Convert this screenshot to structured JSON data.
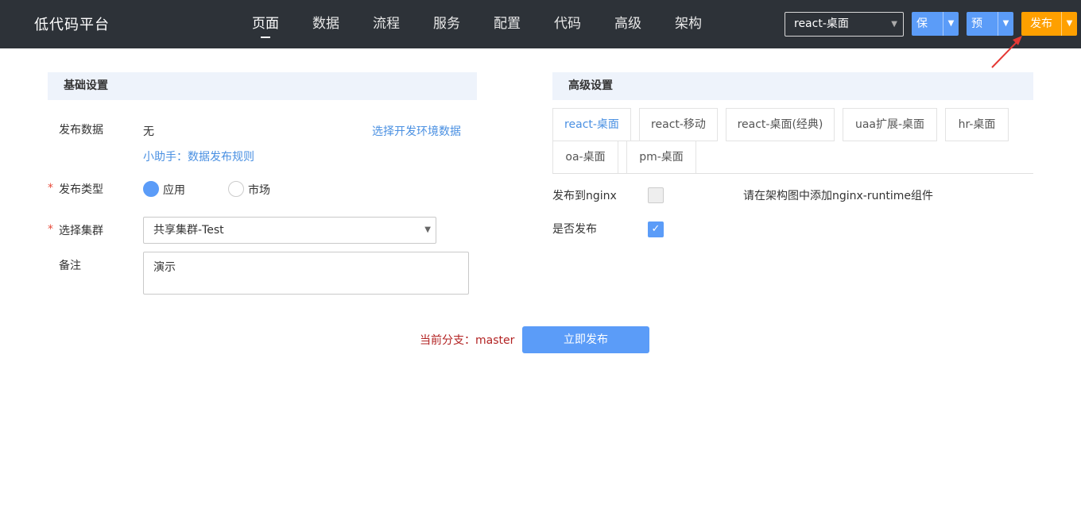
{
  "header": {
    "brand": "低代码平台",
    "nav": [
      "页面",
      "数据",
      "流程",
      "服务",
      "配置",
      "代码",
      "高级",
      "架构"
    ],
    "active_nav": "页面",
    "env_select_value": "react-桌面",
    "save_label": "保存",
    "preview_label": "预览",
    "publish_label": "发布"
  },
  "basic": {
    "title": "基础设置",
    "publish_data_label": "发布数据",
    "publish_data_value": "无",
    "choose_env_link": "选择开发环境数据",
    "helper_link": "小助手：数据发布规则",
    "publish_type_label": "发布类型",
    "publish_type_options": [
      "应用",
      "市场"
    ],
    "publish_type_selected": "应用",
    "cluster_label": "选择集群",
    "cluster_value": "共享集群-Test",
    "remark_label": "备注",
    "remark_value": "演示",
    "required_mark": "*"
  },
  "advanced": {
    "title": "高级设置",
    "tabs": [
      "react-桌面",
      "react-移动",
      "react-桌面(经典)",
      "uaa扩展-桌面",
      "hr-桌面",
      "oa-桌面",
      "pm-桌面"
    ],
    "active_tab": "react-桌面",
    "nginx_label": "发布到nginx",
    "nginx_checked": false,
    "nginx_hint": "请在架构图中添加nginx-runtime组件",
    "do_publish_label": "是否发布",
    "do_publish_checked": true
  },
  "footer": {
    "branch_text": "当前分支：master",
    "submit_label": "立即发布"
  },
  "colors": {
    "topbar": "#2d3238",
    "primary": "#5b9cf8",
    "publish": "#fea000",
    "link": "#4a90e2",
    "branch": "#b22222"
  }
}
